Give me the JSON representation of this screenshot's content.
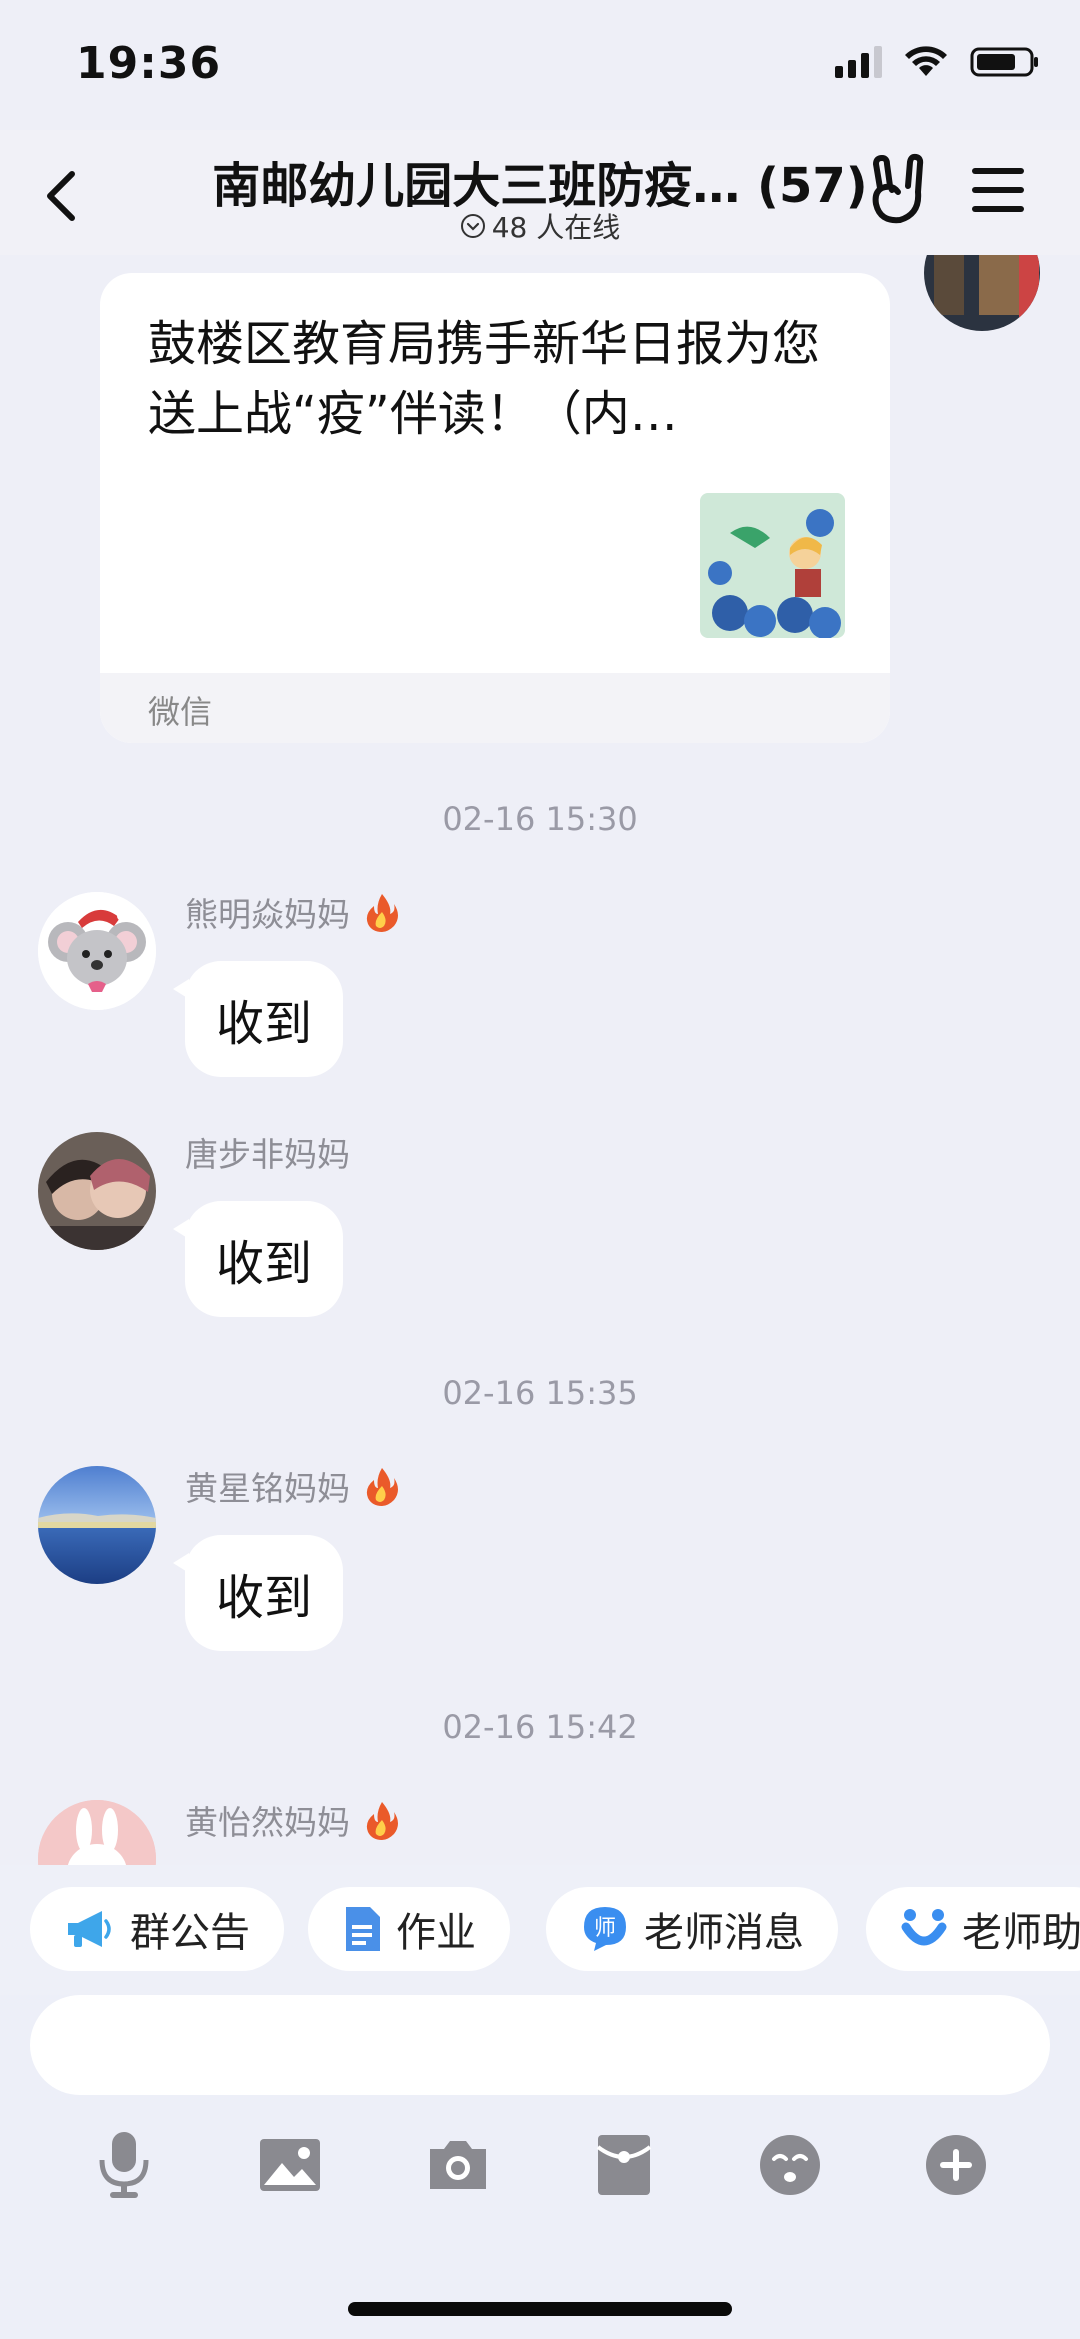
{
  "status_bar": {
    "time": "19:36"
  },
  "nav": {
    "title": "南邮幼儿园大三班防疫…  (57)",
    "online_text": "48 人在线"
  },
  "link_card": {
    "title": "鼓楼区教育局携手新华日报为您送上战“疫”伴读！（内…",
    "source": "微信"
  },
  "messages": [
    {
      "type": "time",
      "text": "02-16 15:30"
    },
    {
      "type": "msg",
      "sender": "熊明焱妈妈",
      "badge": "fire-icon",
      "text": "收到"
    },
    {
      "type": "msg",
      "sender": "唐步非妈妈",
      "text": "收到"
    },
    {
      "type": "time",
      "text": "02-16 15:35"
    },
    {
      "type": "msg",
      "sender": "黄星铭妈妈",
      "badge": "fire-icon",
      "text": "收到"
    },
    {
      "type": "time",
      "text": "02-16 15:42"
    },
    {
      "type": "msg",
      "sender": "黄怡然妈妈",
      "badge": "fire-icon",
      "text": ""
    }
  ],
  "quick_actions": [
    {
      "label": "群公告",
      "icon": "megaphone-icon"
    },
    {
      "label": "作业",
      "icon": "document-icon"
    },
    {
      "label": "老师消息",
      "icon": "teacher-icon"
    },
    {
      "label": "老师助",
      "icon": "smile-icon"
    }
  ],
  "toolbar": {
    "icons": [
      "microphone-icon",
      "image-icon",
      "camera-icon",
      "red-packet-icon",
      "emoji-icon",
      "plus-icon"
    ]
  },
  "colors": {
    "background": "#eeeff7",
    "bubble": "#ffffff",
    "accent": "#3a8ef0"
  }
}
